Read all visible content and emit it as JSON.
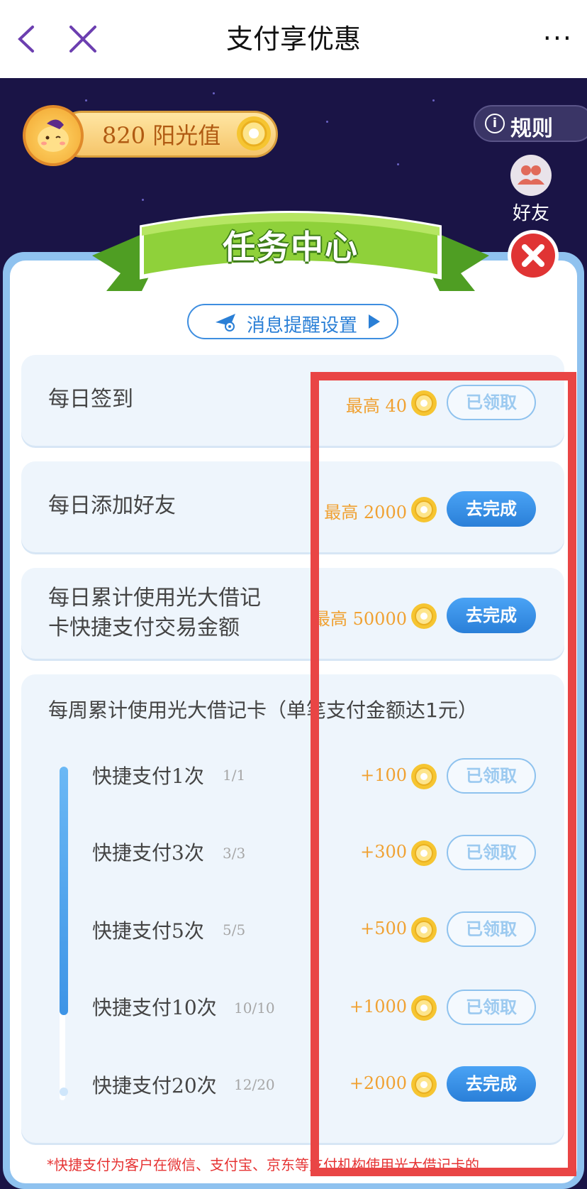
{
  "nav": {
    "title": "支付享优惠",
    "more": "···"
  },
  "header": {
    "sunshine_value": "820 阳光值",
    "rules_label": "规则",
    "friends_label": "好友"
  },
  "panel": {
    "banner_title": "任务中心",
    "message_settings": "消息提醒设置"
  },
  "tasks": [
    {
      "title": "每日签到",
      "reward": "最高 40",
      "button": "已领取",
      "state": "claimed"
    },
    {
      "title": "每日添加好友",
      "reward": "最高 2000",
      "button": "去完成",
      "state": "todo"
    },
    {
      "title_line1": "每日累计使用光大借记",
      "title_line2": "卡快捷支付交易金额",
      "reward": "最高 50000",
      "button": "去完成",
      "state": "todo"
    }
  ],
  "weekly": {
    "title": "每周累计使用光大借记卡（单笔支付金额达1元）",
    "progress": {
      "completed_steps": 4,
      "total_steps": 5
    },
    "items": [
      {
        "title": "快捷支付1次",
        "count": "1/1",
        "reward": "+100",
        "button": "已领取",
        "state": "claimed"
      },
      {
        "title": "快捷支付3次",
        "count": "3/3",
        "reward": "+300",
        "button": "已领取",
        "state": "claimed"
      },
      {
        "title": "快捷支付5次",
        "count": "5/5",
        "reward": "+500",
        "button": "已领取",
        "state": "claimed"
      },
      {
        "title": "快捷支付10次",
        "count": "10/10",
        "reward": "+1000",
        "button": "已领取",
        "state": "claimed"
      },
      {
        "title": "快捷支付20次",
        "count": "12/20",
        "reward": "+2000",
        "button": "去完成",
        "state": "todo"
      }
    ]
  },
  "footnote": "*快捷支付为客户在微信、支付宝、京东等支付机构使用光大借记卡的",
  "colors": {
    "accent_blue": "#2a7fd8",
    "reward_orange": "#f0a132",
    "highlight_red": "#e94545",
    "hero_bg": "#1a1446"
  }
}
